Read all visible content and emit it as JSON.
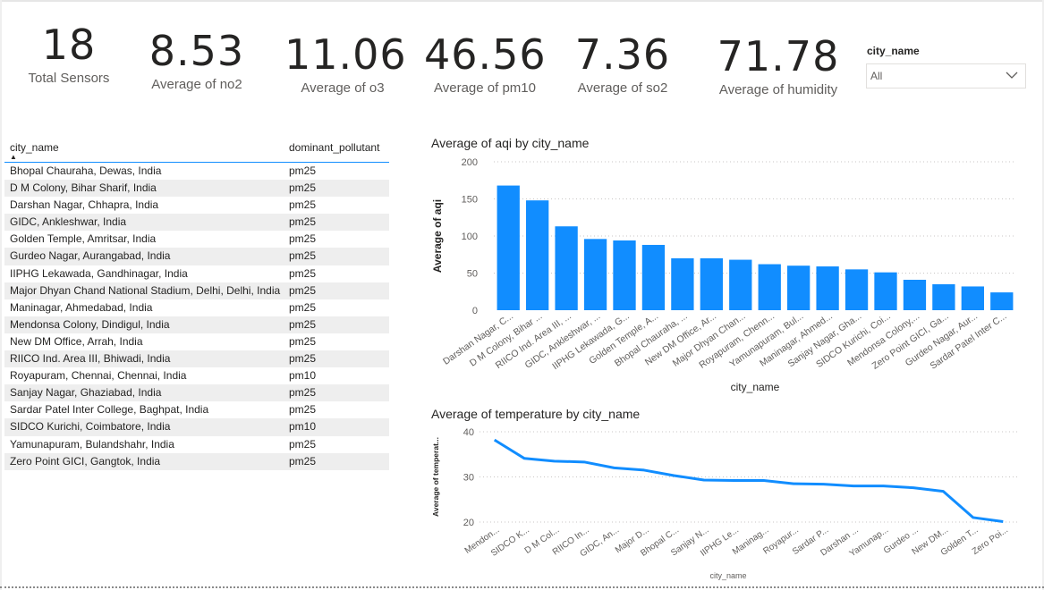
{
  "kpis": [
    {
      "value": "18",
      "label": "Total Sensors"
    },
    {
      "value": "8.53",
      "label": "Average of no2"
    },
    {
      "value": "11.06",
      "label": "Average of o3"
    },
    {
      "value": "46.56",
      "label": "Average of pm10"
    },
    {
      "value": "7.36",
      "label": "Average of so2"
    },
    {
      "value": "71.78",
      "label": "Average of humidity"
    }
  ],
  "slicer": {
    "title": "city_name",
    "value": "All"
  },
  "table": {
    "headers": [
      "city_name",
      "dominant_pollutant"
    ],
    "rows": [
      [
        "Bhopal Chauraha, Dewas, India",
        "pm25"
      ],
      [
        "D M Colony, Bihar Sharif, India",
        "pm25"
      ],
      [
        "Darshan Nagar, Chhapra, India",
        "pm25"
      ],
      [
        "GIDC, Ankleshwar, India",
        "pm25"
      ],
      [
        "Golden Temple, Amritsar, India",
        "pm25"
      ],
      [
        "Gurdeo Nagar, Aurangabad, India",
        "pm25"
      ],
      [
        "IIPHG Lekawada, Gandhinagar, India",
        "pm25"
      ],
      [
        "Major Dhyan Chand National Stadium, Delhi, Delhi, India",
        "pm25"
      ],
      [
        "Maninagar, Ahmedabad, India",
        "pm25"
      ],
      [
        "Mendonsa Colony, Dindigul, India",
        "pm25"
      ],
      [
        "New DM Office, Arrah, India",
        "pm25"
      ],
      [
        "RIICO Ind. Area III, Bhiwadi, India",
        "pm25"
      ],
      [
        "Royapuram, Chennai, Chennai, India",
        "pm10"
      ],
      [
        "Sanjay Nagar, Ghaziabad, India",
        "pm25"
      ],
      [
        "Sardar Patel Inter College, Baghpat, India",
        "pm25"
      ],
      [
        "SIDCO Kurichi, Coimbatore, India",
        "pm10"
      ],
      [
        "Yamunapuram, Bulandshahr, India",
        "pm25"
      ],
      [
        "Zero Point GICI, Gangtok, India",
        "pm25"
      ]
    ]
  },
  "colors": {
    "accent": "#118dff"
  },
  "chart_data": [
    {
      "type": "bar",
      "title": "Average of aqi by city_name",
      "xlabel": "city_name",
      "ylabel": "Average of aqi",
      "ylim": [
        0,
        200
      ],
      "yticks": [
        0,
        50,
        100,
        150,
        200
      ],
      "grid": true,
      "categories": [
        "Darshan Nagar, C...",
        "D M Colony, Bihar ...",
        "RIICO Ind. Area III, ...",
        "GIDC, Ankleshwar, ...",
        "IIPHG Lekawada, G...",
        "Golden Temple, A...",
        "Bhopal Chauraha, ...",
        "New DM Office, Ar...",
        "Major Dhyan Chan...",
        "Royapuram, Chenn...",
        "Yamunapuram, Bul...",
        "Maninagar, Ahmed...",
        "Sanjay Nagar, Gha...",
        "SIDCO Kurichi, Coi...",
        "Mendonsa Colony,...",
        "Zero Point GICI, Ga...",
        "Gurdeo Nagar, Aur...",
        "Sardar Patel Inter C..."
      ],
      "values": [
        168,
        148,
        113,
        96,
        94,
        88,
        70,
        70,
        68,
        62,
        60,
        59,
        55,
        51,
        41,
        35,
        32,
        24
      ]
    },
    {
      "type": "line",
      "title": "Average of temperature by city_name",
      "xlabel": "city_name",
      "ylabel": "Average of temperat...",
      "ylim": [
        20,
        40
      ],
      "yticks": [
        20,
        30,
        40
      ],
      "grid": true,
      "categories": [
        "Mendon...",
        "SIDCO K...",
        "D M Col...",
        "RIICO In...",
        "GIDC, An...",
        "Major D...",
        "Bhopal C...",
        "Sanjay N...",
        "IIPHG Le...",
        "Maninag...",
        "Royapur...",
        "Sardar P...",
        "Darshan ...",
        "Yamunap...",
        "Gurdeo ...",
        "New DM...",
        "Golden T...",
        "Zero Poi..."
      ],
      "values": [
        38.2,
        34.1,
        33.5,
        33.3,
        32.0,
        31.5,
        30.3,
        29.3,
        29.2,
        29.2,
        28.5,
        28.4,
        28.0,
        28.0,
        27.6,
        26.8,
        21.0,
        20.1
      ]
    }
  ]
}
